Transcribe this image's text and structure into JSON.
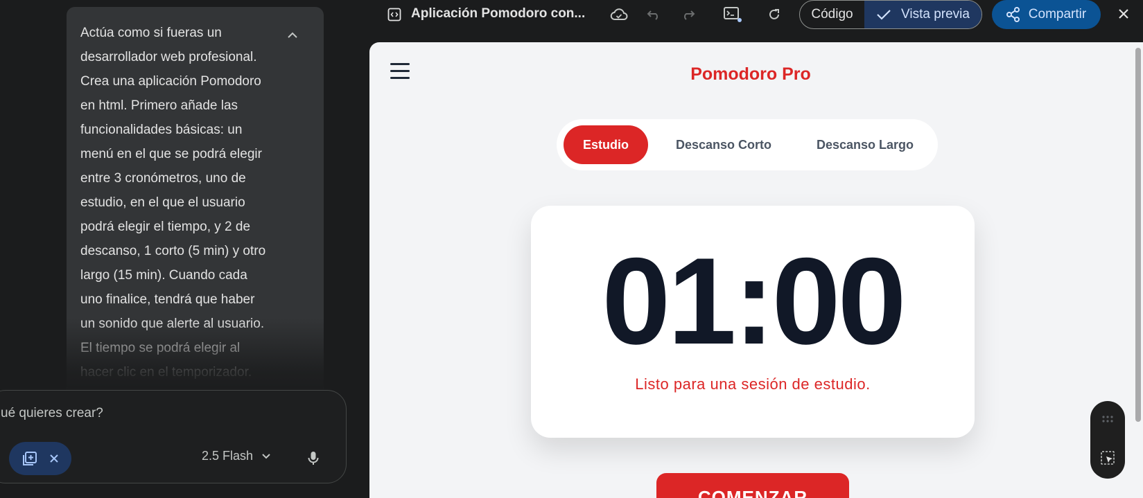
{
  "chat": {
    "prompt_text": "Actúa como si fueras un\ndesarrollador web profesional.\nCrea una aplicación Pomodoro\nen html. Primero añade las\nfuncionalidades básicas: un\nmenú en el que se podrá elegir\nentre 3 cronómetros, uno de\nestudio, en el que el usuario\npodrá elegir el tiempo, y 2 de\ndescanso, 1 corto (5 min) y otro\nlargo (15 min). Cuando cada\nuno finalice, tendrá que haber\nun sonido que alerte al usuario.\nEl tiempo se podrá elegir al\nhacer clic en el temporizador.",
    "input_placeholder": "ué quieres crear?",
    "model_label": "2.5 Flash",
    "icons": [
      "chevron-up-icon",
      "canvas-chip-icon",
      "close-icon",
      "chevron-down-icon",
      "mic-icon"
    ]
  },
  "canvas": {
    "title": "Aplicación Pomodoro con...",
    "code_label": "Código",
    "preview_label": "Vista previa",
    "share_label": "Compartir",
    "icons": [
      "code-doc-icon",
      "cloud-save-icon",
      "undo-icon",
      "redo-icon",
      "console-icon",
      "refresh-icon",
      "check-icon",
      "share-icon",
      "close-icon"
    ]
  },
  "app": {
    "brand": "Pomodoro Pro",
    "tabs": [
      {
        "label": "Estudio",
        "active": true
      },
      {
        "label": "Descanso Corto",
        "active": false
      },
      {
        "label": "Descanso Largo",
        "active": false
      }
    ],
    "timer": "01:00",
    "status": "Listo para una sesión de estudio.",
    "start_label": "COMENZAR"
  },
  "colors": {
    "accent_red": "#dc2626",
    "preview_blue": "#1f3760",
    "share_blue": "#0b5394",
    "dark_bg": "#1b1c1d"
  }
}
